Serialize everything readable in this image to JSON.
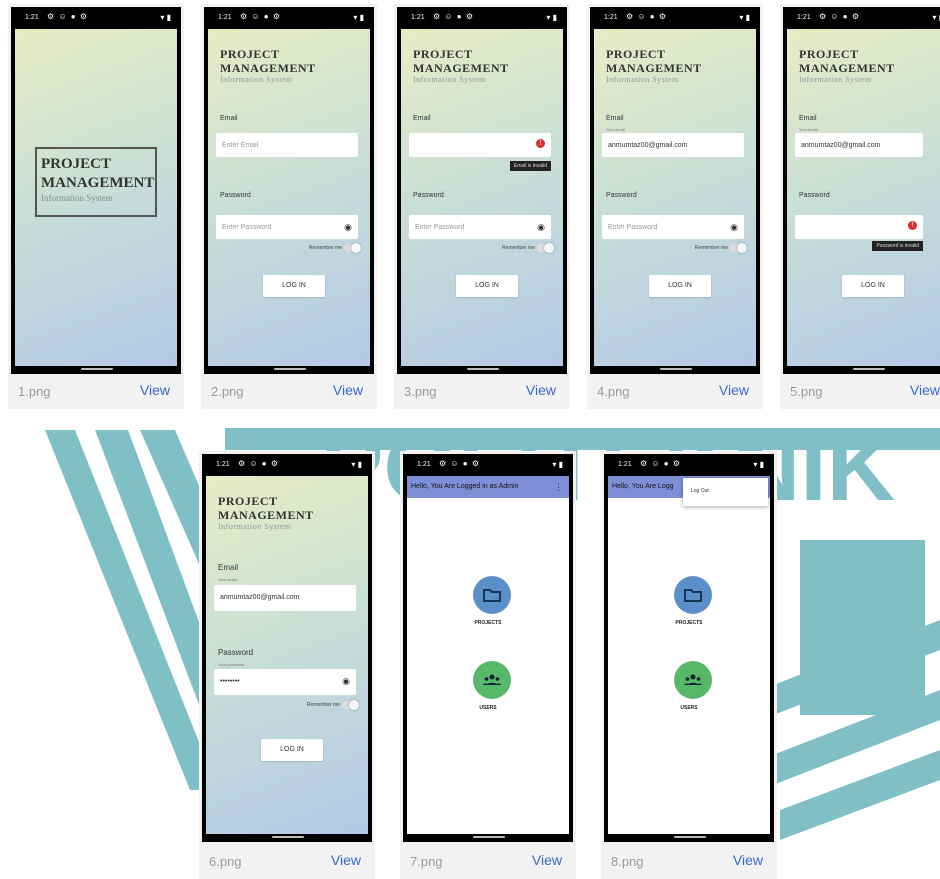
{
  "watermark": {
    "text": "POLITEKNIK",
    "color": "#7fbfc5"
  },
  "app": {
    "logo_line1": "PROJECT",
    "logo_line2": "MANAGEMENT",
    "logo_line3": "Information System",
    "email_label": "Email",
    "email_placeholder": "Enter Email",
    "email_floating_label": "Your email",
    "email_value": "anmumtaz00@gmail.com",
    "password_label": "Password",
    "password_placeholder": "Enter Password",
    "password_floating_label": "Your password",
    "password_value": "••••••••",
    "remember_label": "Remember me",
    "login_button": "LOG IN",
    "email_error": "Email is invalid",
    "password_error": "Password is invalid",
    "appbar_title": "Hello, You Are Logged in as Admin",
    "appbar_title_truncated": "Hello, You Are Logg",
    "menu_logout": "Log Out",
    "projects_label": "PROJECTS",
    "users_label": "USERS",
    "status_time": "1:21",
    "status_icons": "⚙ ☺ ● ⚙",
    "status_signal": "▾ ▮"
  },
  "cards": [
    {
      "file": "1.png",
      "view": "View"
    },
    {
      "file": "2.png",
      "view": "View"
    },
    {
      "file": "3.png",
      "view": "View"
    },
    {
      "file": "4.png",
      "view": "View"
    },
    {
      "file": "5.png",
      "view": "View"
    },
    {
      "file": "6.png",
      "view": "View"
    },
    {
      "file": "7.png",
      "view": "View"
    },
    {
      "file": "8.png",
      "view": "View"
    }
  ],
  "colors": {
    "accent": "#3a67c7",
    "appbar": "#7e8fd8",
    "projects_fab": "#5b8fc9",
    "users_fab": "#58b86a"
  }
}
